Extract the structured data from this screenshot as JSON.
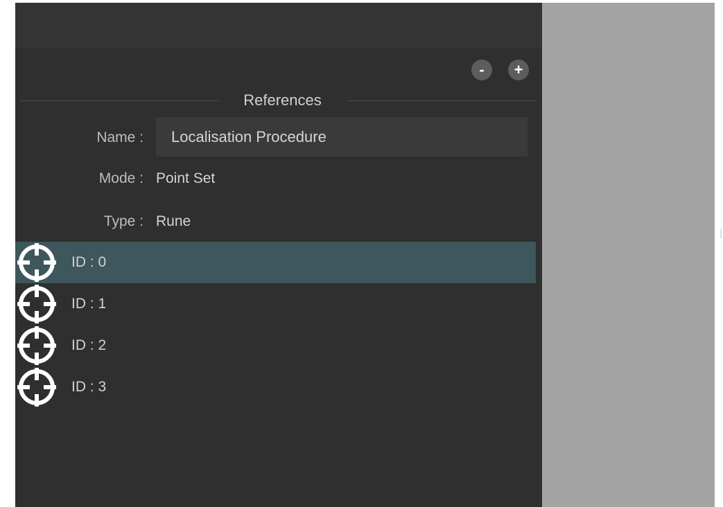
{
  "toolbar": {
    "remove_label": "-",
    "add_label": "+"
  },
  "references": {
    "title": "References",
    "name_label": "Name :",
    "name_value": "Localisation Procedure",
    "mode_label": "Mode :",
    "mode_value": "Point Set",
    "type_label": "Type :",
    "type_value": "Rune"
  },
  "points": [
    {
      "label": "ID : 0",
      "selected": true,
      "icon": "crosshair-icon"
    },
    {
      "label": "ID : 1",
      "selected": false,
      "icon": "crosshair-icon"
    },
    {
      "label": "ID : 2",
      "selected": false,
      "icon": "crosshair-icon"
    },
    {
      "label": "ID : 3",
      "selected": false,
      "icon": "crosshair-icon"
    }
  ],
  "colors": {
    "panel_bg": "#2f2f2f",
    "selected_row": "#3d575c",
    "side_panel": "#a3a3a3"
  }
}
